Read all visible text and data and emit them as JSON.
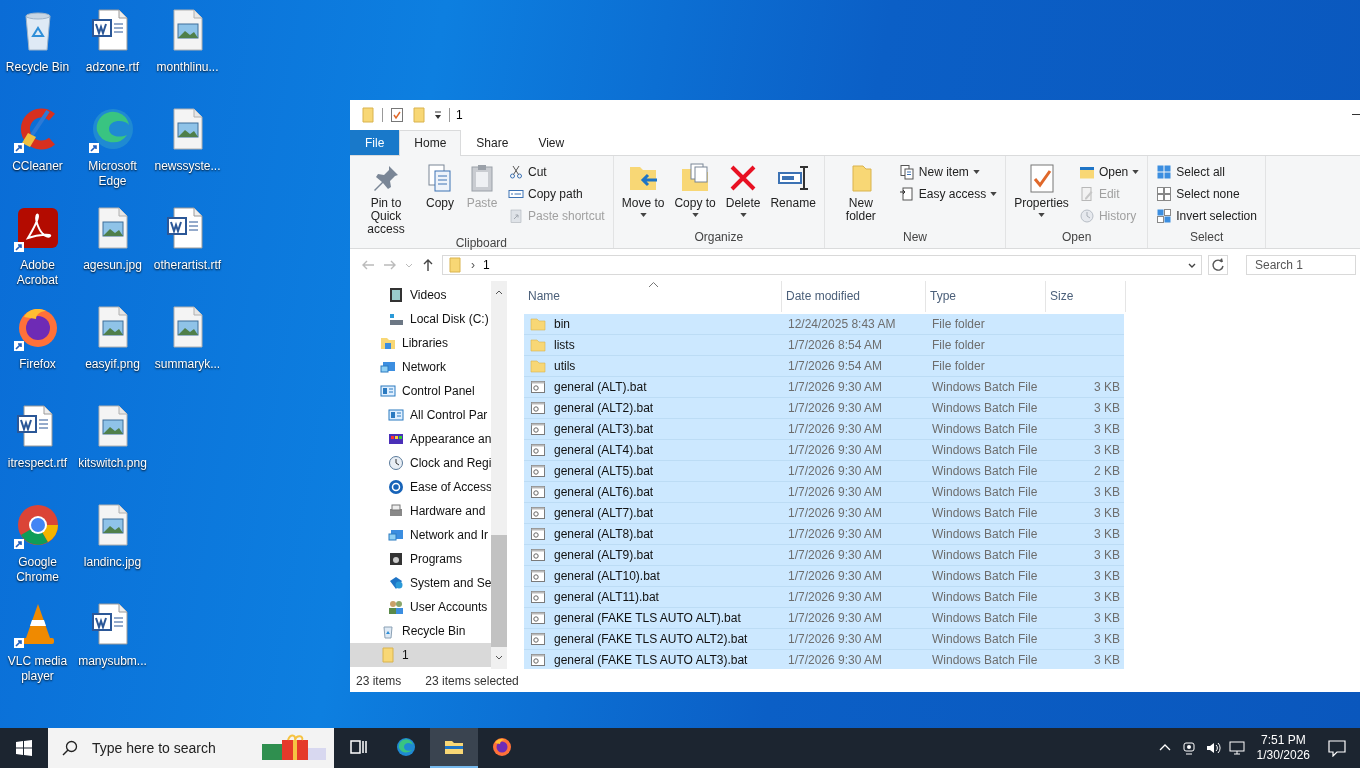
{
  "desktop": {
    "icons": [
      {
        "label": "Recycle Bin",
        "kind": "recycle",
        "shortcut": false
      },
      {
        "label": "CCleaner",
        "kind": "ccleaner",
        "shortcut": true
      },
      {
        "label": "Adobe Acrobat",
        "kind": "acrobat",
        "shortcut": true
      },
      {
        "label": "Firefox",
        "kind": "firefox",
        "shortcut": true
      },
      {
        "label": "itrespect.rtf",
        "kind": "word",
        "shortcut": false
      },
      {
        "label": "Google Chrome",
        "kind": "chrome",
        "shortcut": true
      },
      {
        "label": "VLC media player",
        "kind": "vlc",
        "shortcut": true
      },
      {
        "label": "adzone.rtf",
        "kind": "word",
        "shortcut": false
      },
      {
        "label": "Microsoft Edge",
        "kind": "edge",
        "shortcut": true
      },
      {
        "label": "agesun.jpg",
        "kind": "image",
        "shortcut": false
      },
      {
        "label": "easyif.png",
        "kind": "image",
        "shortcut": false
      },
      {
        "label": "kitswitch.png",
        "kind": "image",
        "shortcut": false
      },
      {
        "label": "landinc.jpg",
        "kind": "image",
        "shortcut": false
      },
      {
        "label": "manysubm...",
        "kind": "word",
        "shortcut": false
      },
      {
        "label": "monthlinu...",
        "kind": "image",
        "shortcut": false
      },
      {
        "label": "newssyste...",
        "kind": "image",
        "shortcut": false
      },
      {
        "label": "otherartist.rtf",
        "kind": "word",
        "shortcut": false
      },
      {
        "label": "summaryk...",
        "kind": "image",
        "shortcut": false
      }
    ]
  },
  "explorer": {
    "title": "1",
    "tabs": [
      {
        "label": "File",
        "kind": "file",
        "selected": false
      },
      {
        "label": "Home",
        "kind": "tab",
        "selected": true
      },
      {
        "label": "Share",
        "kind": "tab",
        "selected": false
      },
      {
        "label": "View",
        "kind": "tab",
        "selected": false
      }
    ],
    "ribbon": [
      {
        "label": "Clipboard",
        "large": [
          {
            "label": "Pin to Quick access",
            "disabled": false,
            "dropdown": false
          },
          {
            "label": "Copy",
            "disabled": false,
            "dropdown": false
          },
          {
            "label": "Paste",
            "disabled": true,
            "dropdown": false
          }
        ],
        "small": [
          {
            "label": "Cut",
            "disabled": false,
            "dropdown": false
          },
          {
            "label": "Copy path",
            "disabled": false,
            "dropdown": false
          },
          {
            "label": "Paste shortcut",
            "disabled": true,
            "dropdown": false
          }
        ]
      },
      {
        "label": "Organize",
        "large": [
          {
            "label": "Move to",
            "disabled": false,
            "dropdown": true
          },
          {
            "label": "Copy to",
            "disabled": false,
            "dropdown": true
          },
          {
            "label": "Delete",
            "disabled": false,
            "dropdown": true
          },
          {
            "label": "Rename",
            "disabled": false,
            "dropdown": false
          }
        ]
      },
      {
        "label": "New",
        "large": [
          {
            "label": "New folder",
            "disabled": false,
            "dropdown": false
          }
        ],
        "small": [
          {
            "label": "New item",
            "disabled": false,
            "dropdown": true
          },
          {
            "label": "Easy access",
            "disabled": false,
            "dropdown": true
          }
        ]
      },
      {
        "label": "Open",
        "large": [
          {
            "label": "Properties",
            "disabled": false,
            "dropdown": true
          }
        ],
        "small": [
          {
            "label": "Open",
            "disabled": false,
            "dropdown": true
          },
          {
            "label": "Edit",
            "disabled": true,
            "dropdown": false
          },
          {
            "label": "History",
            "disabled": true,
            "dropdown": false
          }
        ]
      },
      {
        "label": "Select",
        "small": [
          {
            "label": "Select all",
            "disabled": false,
            "dropdown": false
          },
          {
            "label": "Select none",
            "disabled": false,
            "dropdown": false
          },
          {
            "label": "Invert selection",
            "disabled": false,
            "dropdown": false
          }
        ]
      }
    ],
    "address": {
      "separator": "›",
      "path": "1"
    },
    "search": {
      "placeholder": "Search 1"
    },
    "nav": [
      {
        "children": [
          {
            "label": "Videos",
            "kind": "videos",
            "selected": false
          },
          {
            "label": "Local Disk (C:)",
            "kind": "disk",
            "selected": false
          }
        ]
      },
      {
        "label": "Libraries",
        "kind": "libraries",
        "selected": false
      },
      {
        "label": "Network",
        "kind": "network",
        "selected": false
      },
      {
        "label": "Control Panel",
        "kind": "control",
        "selected": false,
        "children": [
          {
            "label": "All Control Par",
            "kind": "control",
            "selected": false
          },
          {
            "label": "Appearance an",
            "kind": "appearance",
            "selected": false
          },
          {
            "label": "Clock and Regi",
            "kind": "clock",
            "selected": false
          },
          {
            "label": "Ease of Access",
            "kind": "ease",
            "selected": false
          },
          {
            "label": "Hardware and",
            "kind": "hardware",
            "selected": false
          },
          {
            "label": "Network and Ir",
            "kind": "network",
            "selected": false
          },
          {
            "label": "Programs",
            "kind": "programs",
            "selected": false
          },
          {
            "label": "System and Se",
            "kind": "security",
            "selected": false
          },
          {
            "label": "User Accounts",
            "kind": "users",
            "selected": false
          }
        ]
      },
      {
        "label": "Recycle Bin",
        "kind": "recycle",
        "selected": false
      },
      {
        "label": "1",
        "kind": "folder",
        "selected": true
      }
    ],
    "columns": [
      {
        "label": "Name",
        "sorted": true
      },
      {
        "label": "Date modified",
        "sorted": false
      },
      {
        "label": "Type",
        "sorted": false
      },
      {
        "label": "Size",
        "sorted": false
      }
    ],
    "files": [
      {
        "name": "bin",
        "kind": "folder",
        "date": "12/24/2025 8:43 AM",
        "type": "File folder",
        "selected": true
      },
      {
        "name": "lists",
        "kind": "folder",
        "date": "1/7/2026 8:54 AM",
        "type": "File folder",
        "selected": true
      },
      {
        "name": "utils",
        "kind": "folder",
        "date": "1/7/2026 9:54 AM",
        "type": "File folder",
        "selected": true
      },
      {
        "name": "general (ALT).bat",
        "kind": "bat",
        "date": "1/7/2026 9:30 AM",
        "type": "Windows Batch File",
        "size": "3 KB",
        "selected": true
      },
      {
        "name": "general (ALT2).bat",
        "kind": "bat",
        "date": "1/7/2026 9:30 AM",
        "type": "Windows Batch File",
        "size": "3 KB",
        "selected": true
      },
      {
        "name": "general (ALT3).bat",
        "kind": "bat",
        "date": "1/7/2026 9:30 AM",
        "type": "Windows Batch File",
        "size": "3 KB",
        "selected": true
      },
      {
        "name": "general (ALT4).bat",
        "kind": "bat",
        "date": "1/7/2026 9:30 AM",
        "type": "Windows Batch File",
        "size": "3 KB",
        "selected": true
      },
      {
        "name": "general (ALT5).bat",
        "kind": "bat",
        "date": "1/7/2026 9:30 AM",
        "type": "Windows Batch File",
        "size": "2 KB",
        "selected": true
      },
      {
        "name": "general (ALT6).bat",
        "kind": "bat",
        "date": "1/7/2026 9:30 AM",
        "type": "Windows Batch File",
        "size": "3 KB",
        "selected": true
      },
      {
        "name": "general (ALT7).bat",
        "kind": "bat",
        "date": "1/7/2026 9:30 AM",
        "type": "Windows Batch File",
        "size": "3 KB",
        "selected": true
      },
      {
        "name": "general (ALT8).bat",
        "kind": "bat",
        "date": "1/7/2026 9:30 AM",
        "type": "Windows Batch File",
        "size": "3 KB",
        "selected": true
      },
      {
        "name": "general (ALT9).bat",
        "kind": "bat",
        "date": "1/7/2026 9:30 AM",
        "type": "Windows Batch File",
        "size": "3 KB",
        "selected": true
      },
      {
        "name": "general (ALT10).bat",
        "kind": "bat",
        "date": "1/7/2026 9:30 AM",
        "type": "Windows Batch File",
        "size": "3 KB",
        "selected": true
      },
      {
        "name": "general (ALT11).bat",
        "kind": "bat",
        "date": "1/7/2026 9:30 AM",
        "type": "Windows Batch File",
        "size": "3 KB",
        "selected": true
      },
      {
        "name": "general (FAKE TLS AUTO ALT).bat",
        "kind": "bat",
        "date": "1/7/2026 9:30 AM",
        "type": "Windows Batch File",
        "size": "3 KB",
        "selected": true
      },
      {
        "name": "general (FAKE TLS AUTO ALT2).bat",
        "kind": "bat",
        "date": "1/7/2026 9:30 AM",
        "type": "Windows Batch File",
        "size": "3 KB",
        "selected": true
      },
      {
        "name": "general (FAKE TLS AUTO ALT3).bat",
        "kind": "bat",
        "date": "1/7/2026 9:30 AM",
        "type": "Windows Batch File",
        "size": "3 KB",
        "selected": true
      }
    ],
    "status": [
      "23 items",
      "23 items selected"
    ]
  },
  "taskbar": {
    "search_placeholder": "Type here to search",
    "apps": [
      {
        "kind": "taskview",
        "active": false
      },
      {
        "kind": "edge",
        "active": false
      },
      {
        "kind": "explorer",
        "active": true
      },
      {
        "kind": "firefox",
        "active": false
      }
    ],
    "time": "7:51 PM",
    "date": "1/30/2026"
  }
}
